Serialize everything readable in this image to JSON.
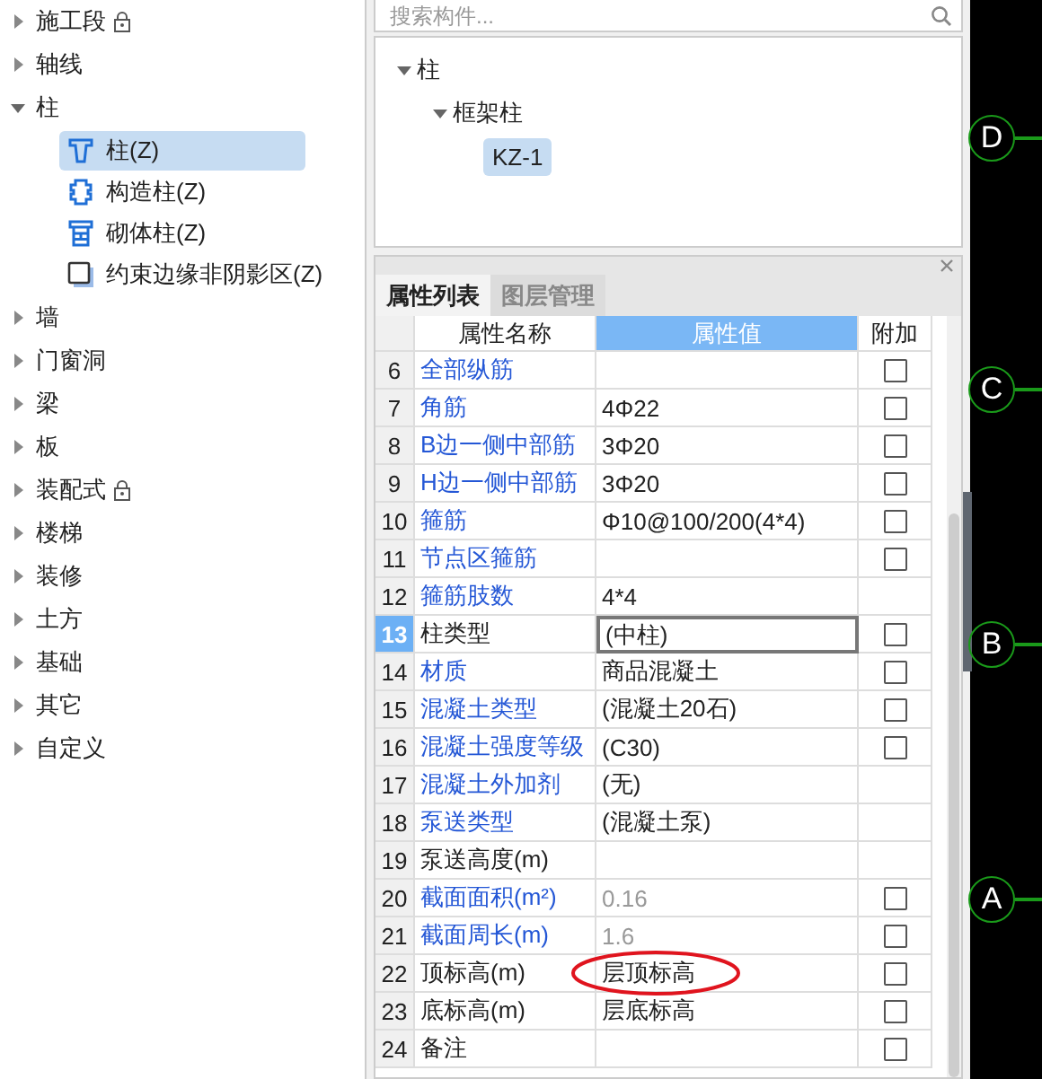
{
  "left_tree": [
    {
      "label": "施工段",
      "expanded": false,
      "locked": true
    },
    {
      "label": "轴线",
      "expanded": false,
      "locked": false
    },
    {
      "label": "柱",
      "expanded": true,
      "locked": false,
      "children": [
        {
          "label": "柱(Z)",
          "kind": "column",
          "selected": true
        },
        {
          "label": "构造柱(Z)",
          "kind": "structural",
          "selected": false
        },
        {
          "label": "砌体柱(Z)",
          "kind": "masonry",
          "selected": false
        },
        {
          "label": "约束边缘非阴影区(Z)",
          "kind": "boundary",
          "selected": false
        }
      ]
    },
    {
      "label": "墙",
      "expanded": false,
      "locked": false
    },
    {
      "label": "门窗洞",
      "expanded": false,
      "locked": false
    },
    {
      "label": "梁",
      "expanded": false,
      "locked": false
    },
    {
      "label": "板",
      "expanded": false,
      "locked": false
    },
    {
      "label": "装配式",
      "expanded": false,
      "locked": true
    },
    {
      "label": "楼梯",
      "expanded": false,
      "locked": false
    },
    {
      "label": "装修",
      "expanded": false,
      "locked": false
    },
    {
      "label": "土方",
      "expanded": false,
      "locked": false
    },
    {
      "label": "基础",
      "expanded": false,
      "locked": false
    },
    {
      "label": "其它",
      "expanded": false,
      "locked": false
    },
    {
      "label": "自定义",
      "expanded": false,
      "locked": false
    }
  ],
  "search": {
    "placeholder": "搜索构件..."
  },
  "component_tree": [
    {
      "label": "柱",
      "expanded": true,
      "children": [
        {
          "label": "框架柱",
          "expanded": true,
          "children": [
            {
              "label": "KZ-1",
              "selected": true
            }
          ]
        }
      ]
    }
  ],
  "property_panel": {
    "tabs": [
      {
        "label": "属性列表",
        "selected": true
      },
      {
        "label": "图层管理",
        "selected": false
      }
    ],
    "columns": [
      "属性名称",
      "属性值",
      "附加"
    ],
    "rows": [
      {
        "num": "6",
        "name": "全部纵筋",
        "public": true,
        "value": "",
        "muted": false,
        "checked": false,
        "selected": false
      },
      {
        "num": "7",
        "name": "角筋",
        "public": true,
        "value": "4Φ22",
        "muted": false,
        "checked": false,
        "selected": false
      },
      {
        "num": "8",
        "name": "B边一侧中部筋",
        "public": true,
        "value": "3Φ20",
        "muted": false,
        "checked": false,
        "selected": false
      },
      {
        "num": "9",
        "name": "H边一侧中部筋",
        "public": true,
        "value": "3Φ20",
        "muted": false,
        "checked": false,
        "selected": false
      },
      {
        "num": "10",
        "name": "箍筋",
        "public": true,
        "value": "Φ10@100/200(4*4)",
        "muted": false,
        "checked": false,
        "selected": false
      },
      {
        "num": "11",
        "name": "节点区箍筋",
        "public": true,
        "value": "",
        "muted": false,
        "checked": false,
        "selected": false
      },
      {
        "num": "12",
        "name": "箍筋肢数",
        "public": true,
        "value": "4*4",
        "muted": false,
        "selected": false
      },
      {
        "num": "13",
        "name": "柱类型",
        "public": false,
        "value": "(中柱)",
        "muted": false,
        "checked": false,
        "selected": true
      },
      {
        "num": "14",
        "name": "材质",
        "public": true,
        "value": "商品混凝土",
        "muted": false,
        "checked": false,
        "selected": false
      },
      {
        "num": "15",
        "name": "混凝土类型",
        "public": true,
        "value": "(混凝土20石)",
        "muted": false,
        "checked": false,
        "selected": false
      },
      {
        "num": "16",
        "name": "混凝土强度等级",
        "public": true,
        "value": "(C30)",
        "muted": false,
        "checked": false,
        "selected": false
      },
      {
        "num": "17",
        "name": "混凝土外加剂",
        "public": true,
        "value": "(无)",
        "muted": false,
        "selected": false
      },
      {
        "num": "18",
        "name": "泵送类型",
        "public": true,
        "value": "(混凝土泵)",
        "muted": false,
        "selected": false
      },
      {
        "num": "19",
        "name": "泵送高度(m)",
        "public": false,
        "value": "",
        "muted": false,
        "selected": false
      },
      {
        "num": "20",
        "name": "截面面积(m²)",
        "public": true,
        "value": "0.16",
        "muted": true,
        "checked": false,
        "selected": false
      },
      {
        "num": "21",
        "name": "截面周长(m)",
        "public": true,
        "value": "1.6",
        "muted": true,
        "checked": false,
        "selected": false
      },
      {
        "num": "22",
        "name": "顶标高(m)",
        "public": false,
        "value": "层顶标高",
        "muted": false,
        "checked": false,
        "selected": false
      },
      {
        "num": "23",
        "name": "底标高(m)",
        "public": false,
        "value": "层底标高",
        "muted": false,
        "checked": false,
        "selected": false
      },
      {
        "num": "24",
        "name": "备注",
        "public": false,
        "value": "",
        "muted": false,
        "checked": false,
        "selected": false
      }
    ]
  },
  "canvas": {
    "axes": [
      {
        "label": "D"
      },
      {
        "label": "C"
      },
      {
        "label": "B"
      },
      {
        "label": "A"
      }
    ]
  }
}
